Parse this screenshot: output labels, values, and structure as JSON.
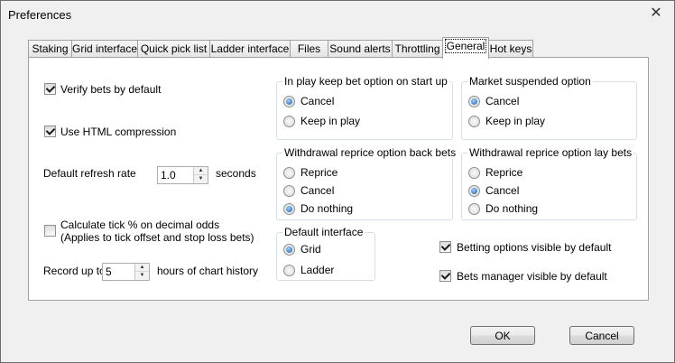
{
  "window": {
    "title": "Preferences",
    "close_glyph": "✕"
  },
  "tabs": [
    "Staking",
    "Grid interface",
    "Quick pick list",
    "Ladder interface",
    "Files",
    "Sound alerts",
    "Throttling",
    "General",
    "Hot keys"
  ],
  "active_tab": "General",
  "general": {
    "verify_bets": {
      "label": "Verify bets by default",
      "checked": true
    },
    "html_compression": {
      "label": "Use HTML compression",
      "checked": true
    },
    "refresh_rate": {
      "label": "Default refresh rate",
      "value": "1.0",
      "unit": "seconds"
    },
    "tick_percent": {
      "label_line1": "Calculate tick % on decimal odds",
      "label_line2": "(Applies to tick offset and stop loss bets)",
      "checked": false
    },
    "chart_history": {
      "prefix": "Record up to",
      "value": "5",
      "suffix": "hours of chart history"
    },
    "in_play_group": {
      "title": "In play keep bet option on start up",
      "options": [
        "Cancel",
        "Keep in play"
      ],
      "selected": "Cancel"
    },
    "market_suspended_group": {
      "title": "Market suspended option",
      "options": [
        "Cancel",
        "Keep in play"
      ],
      "selected": "Cancel"
    },
    "withdrawal_back_group": {
      "title": "Withdrawal reprice option back bets",
      "options": [
        "Reprice",
        "Cancel",
        "Do nothing"
      ],
      "selected": "Do nothing"
    },
    "withdrawal_lay_group": {
      "title": "Withdrawal reprice option lay bets",
      "options": [
        "Reprice",
        "Cancel",
        "Do nothing"
      ],
      "selected": "Cancel"
    },
    "default_interface_group": {
      "title": "Default interface",
      "options": [
        "Grid",
        "Ladder"
      ],
      "selected": "Grid"
    },
    "betting_options_visible": {
      "label": "Betting options visible by default",
      "checked": true
    },
    "bets_manager_visible": {
      "label": "Bets manager visible by default",
      "checked": true
    }
  },
  "buttons": {
    "ok": "OK",
    "cancel": "Cancel"
  }
}
